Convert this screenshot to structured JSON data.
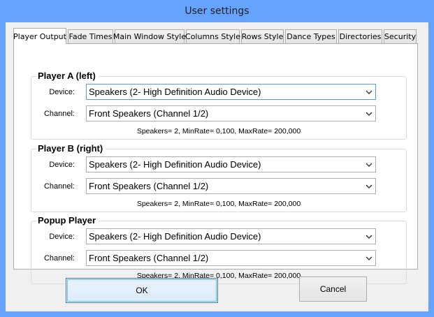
{
  "window": {
    "title": "User settings"
  },
  "tabs": [
    {
      "label": "Player Output",
      "active": true
    },
    {
      "label": "Fade Times",
      "active": false
    },
    {
      "label": "Main Window Style",
      "active": false
    },
    {
      "label": "Columns Style",
      "active": false
    },
    {
      "label": "Rows Style",
      "active": false
    },
    {
      "label": "Dance Types",
      "active": false
    },
    {
      "label": "Directories",
      "active": false
    },
    {
      "label": "Security",
      "active": false
    }
  ],
  "groups": [
    {
      "title": "Player A (left)",
      "device_label": "Device:",
      "device_value": "Speakers (2- High Definition Audio Device)",
      "channel_label": "Channel:",
      "channel_value": "Front Speakers (Channel 1/2)",
      "info": "Speakers= 2, MinRate= 0,100, MaxRate= 200,000"
    },
    {
      "title": "Player B (right)",
      "device_label": "Device:",
      "device_value": "Speakers (2- High Definition Audio Device)",
      "channel_label": "Channel:",
      "channel_value": "Front Speakers (Channel 1/2)",
      "info": "Speakers= 2, MinRate= 0,100, MaxRate= 200,000"
    },
    {
      "title": "Popup Player",
      "device_label": "Device:",
      "device_value": "Speakers (2- High Definition Audio Device)",
      "channel_label": "Channel:",
      "channel_value": "Front Speakers (Channel 1/2)",
      "info": "Speakers= 2, MinRate= 0,100, MaxRate= 200,000"
    }
  ],
  "buttons": {
    "ok": "OK",
    "cancel": "Cancel"
  },
  "icons": {
    "dropdown": "chevron-down-icon"
  },
  "colors": {
    "frame": "#66a3ff",
    "focus_border": "#569de5"
  }
}
